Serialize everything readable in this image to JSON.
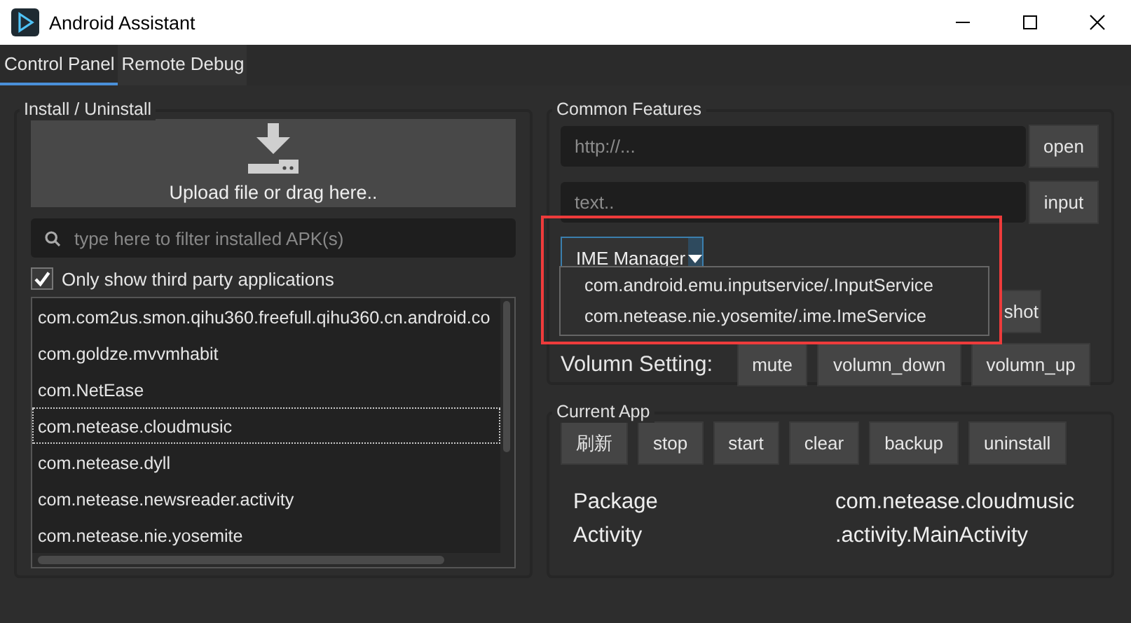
{
  "window": {
    "title": "Android Assistant"
  },
  "tabs": [
    {
      "label": "Control Panel",
      "selected": true
    },
    {
      "label": "Remote Debug",
      "selected": false
    }
  ],
  "install": {
    "title": "Install / Uninstall",
    "upload_label": "Upload file or drag here..",
    "search": {
      "placeholder": "type here to filter installed APK(s)"
    },
    "third_party_only": {
      "label": "Only show third party applications",
      "checked": true
    },
    "packages": [
      {
        "name": "com.com2us.smon.qihu360.freefull.qihu360.cn.android.co",
        "selected": false
      },
      {
        "name": "com.goldze.mvvmhabit",
        "selected": false
      },
      {
        "name": "com.NetEase",
        "selected": false
      },
      {
        "name": "com.netease.cloudmusic",
        "selected": true
      },
      {
        "name": "com.netease.dyll",
        "selected": false
      },
      {
        "name": "com.netease.newsreader.activity",
        "selected": false
      },
      {
        "name": "com.netease.nie.yosemite",
        "selected": false
      }
    ]
  },
  "common_features": {
    "title": "Common Features",
    "url": {
      "placeholder": "http://..."
    },
    "open_button": "open",
    "text": {
      "placeholder": "text.."
    },
    "input_button": "input",
    "ime_manager": {
      "value": "IME Manager",
      "expanded": true,
      "options": [
        "com.android.emu.inputservice/.InputService",
        "com.netease.nie.yosemite/.ime.ImeService"
      ]
    },
    "partial_button": "shot",
    "volume": {
      "label": "Volumn Setting:",
      "buttons": [
        "mute",
        "volumn_down",
        "volumn_up"
      ]
    }
  },
  "current_app": {
    "title": "Current App",
    "buttons": [
      "刷新",
      "stop",
      "start",
      "clear",
      "backup",
      "uninstall"
    ],
    "info": [
      {
        "label": "Package",
        "value": "com.netease.cloudmusic"
      },
      {
        "label": "Activity",
        "value": ".activity.MainActivity"
      }
    ]
  }
}
